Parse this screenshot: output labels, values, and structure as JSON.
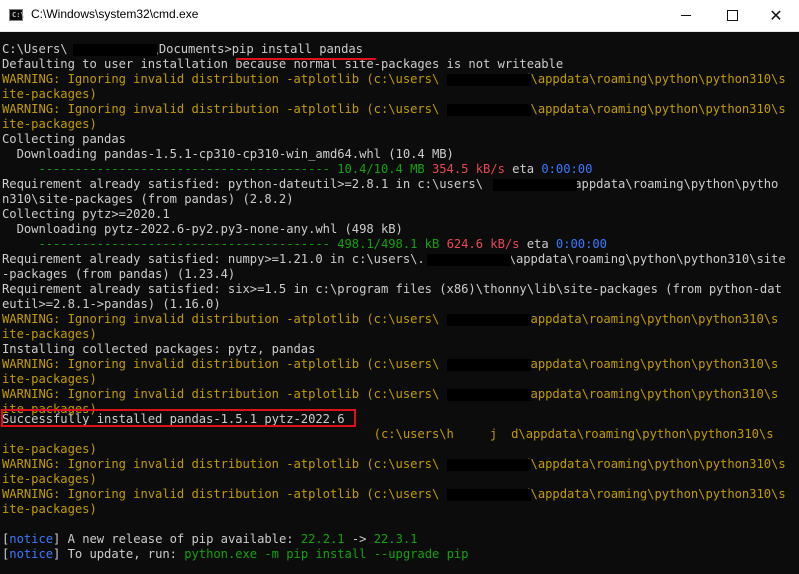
{
  "window": {
    "title": "C:\\Windows\\system32\\cmd.exe",
    "icon_label": "C:\\",
    "controls": {
      "minimize": "minimize",
      "maximize": "maximize",
      "close": "✕"
    }
  },
  "colors": {
    "background": "#0c0c0c",
    "text": "#cccccc",
    "warning": "#c19c00",
    "progress": "#13a10e",
    "speed": "#e74856",
    "notice": "#3b78ff",
    "annotation": "#e0101a"
  },
  "console": {
    "prompt": {
      "user_prefix": "C:\\Users\\",
      "documents": "\\Documents>",
      "command": "pip install pandas"
    },
    "l2": "Defaulting to user installation because normal site-packages is not writeable",
    "l3": {
      "a": "WARNING: Ignoring invalid distribution -atplotlib (c:\\users\\",
      "b": "d\\appdata\\roaming\\python\\python310\\s"
    },
    "l4": "ite-packages)",
    "l5": {
      "a": "WARNING: Ignoring invalid distribution -atplotlib (c:\\users\\",
      "b": ".\\appdata\\roaming\\python\\python310\\s"
    },
    "l6": "ite-packages)",
    "l7": "Collecting pandas",
    "l8": "  Downloading pandas-1.5.1-cp310-cp310-win_amd64.whl (10.4 MB)",
    "l9": {
      "bar": "     ---------------------------------------- ",
      "size": "10.4/10.4 MB",
      "speed": "354.5 kB/s",
      "eta_label": "eta",
      "eta": "0:00:00"
    },
    "l10": {
      "a": "Requirement already satisfied: python-dateutil>=2.8.1 in c:\\users\\",
      "b": "\\appdata\\roaming\\python\\pytho"
    },
    "l11": "n310\\site-packages (from pandas) (2.8.2)",
    "l12": "Collecting pytz>=2020.1",
    "l13": "  Downloading pytz-2022.6-py2.py3-none-any.whl (498 kB)",
    "l14": {
      "bar": "     ---------------------------------------- ",
      "size": "498.1/498.1 kB",
      "speed": "624.6 kB/s",
      "eta_label": "eta",
      "eta": "0:00:00"
    },
    "l15": {
      "a": "Requirement already satisfied: numpy>=1.21.0 in c:\\users\\.",
      "b": "\\appdata\\roaming\\python\\python310\\site"
    },
    "l16": "-packages (from pandas) (1.23.4)",
    "l17": "Requirement already satisfied: six>=1.5 in c:\\program files (x86)\\thonny\\lib\\site-packages (from python-dat",
    "l18": "eutil>=2.8.1->pandas) (1.16.0)",
    "l19": {
      "a": "WARNING: Ignoring invalid distribution -atplotlib (c:\\users\\",
      "b": "\\appdata\\roaming\\python\\python310\\s"
    },
    "l20": "ite-packages)",
    "l21": "Installing collected packages: pytz, pandas",
    "l22": {
      "a": "WARNING: Ignoring invalid distribution -atplotlib (c:\\users\\",
      "b": "\\appdata\\roaming\\python\\python310\\s"
    },
    "l23": "ite-packages)",
    "l24": {
      "a": "WARNING: Ignoring invalid distribution -atplotlib (c:\\users\\",
      "b": "\\appdata\\roaming\\python\\python310\\s"
    },
    "l25": "ite-packages)",
    "l26": "Successfully installed pandas-1.5.1 pytz-2022.6",
    "l27": {
      "a": "                                                   (c:\\users\\h",
      "mid": "j",
      "b": "d\\appdata\\roaming\\python\\python310\\s"
    },
    "l28": "ite-packages)",
    "l29": {
      "a": "WARNING: Ignoring invalid distribution -atplotlib (c:\\users\\",
      "b": "d\\appdata\\roaming\\python\\python310\\s"
    },
    "l30": "ite-packages)",
    "l31": {
      "a": "WARNING: Ignoring invalid distribution -atplotlib (c:\\users\\",
      "b": "d\\appdata\\roaming\\python\\python310\\s"
    },
    "l32": "ite-packages)",
    "n1": {
      "open": "[",
      "tag": "notice",
      "close": "]",
      "text": " A new release of pip available: ",
      "old": "22.2.1",
      "arrow": " -> ",
      "new": "22.3.1"
    },
    "n2": {
      "open": "[",
      "tag": "notice",
      "close": "]",
      "text": " To update, run: ",
      "cmd": "python.exe -m pip install --upgrade pip"
    }
  }
}
